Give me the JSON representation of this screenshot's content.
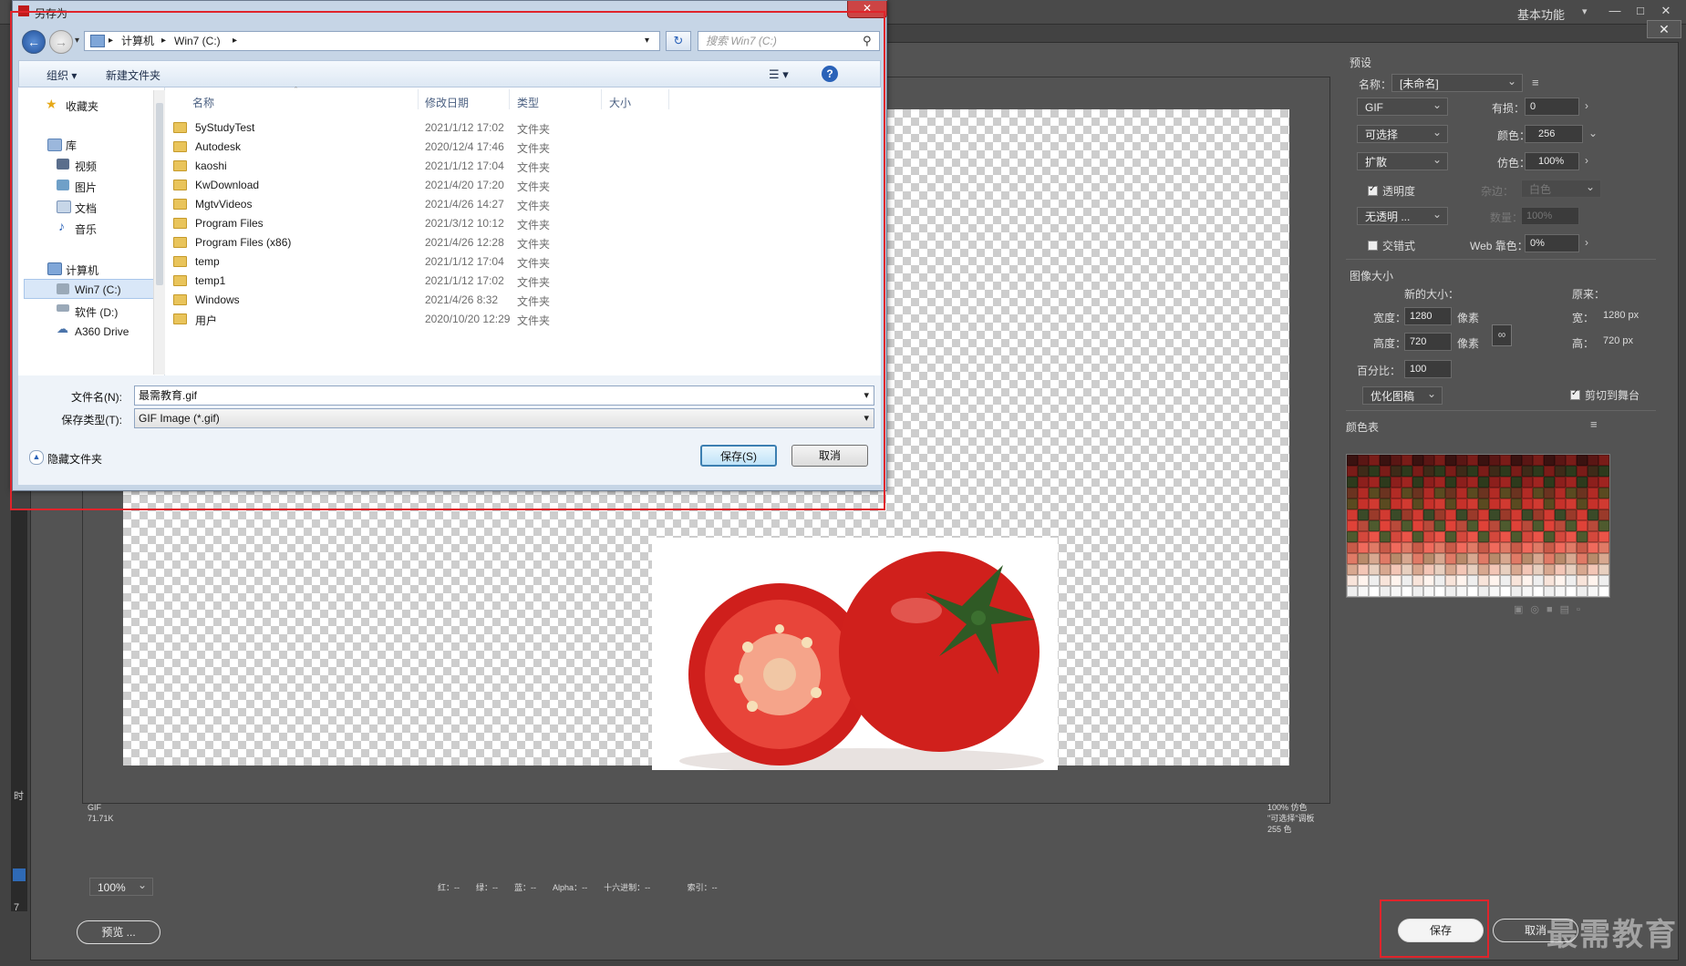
{
  "photoshop": {
    "workspace": "基本功能",
    "left_strip_chars": [
      "时",
      "7"
    ],
    "image_info_left": [
      "GIF",
      "71.71K"
    ],
    "image_info_right": [
      "100% 仿色",
      "\"可选择\"调板",
      "255 色"
    ],
    "zoom": "100%",
    "readout": {
      "r": "红：--",
      "g": "绿：--",
      "b": "蓝：--",
      "alpha": "Alpha：--",
      "hex": "十六进制：--",
      "index": "索引：--"
    },
    "preview_button": "预览 ...",
    "save_button": "保存",
    "cancel_button": "取消",
    "watermark": "最需教育"
  },
  "panel": {
    "preset_header": "预设",
    "name_label": "名称：",
    "name_value": "[未命名]",
    "format": "GIF",
    "lossy_label": "有损：",
    "lossy_value": "0",
    "reduction": "可选择",
    "colors_label": "颜色：",
    "colors_value": "256",
    "dither_algo": "扩散",
    "dither_label": "仿色：",
    "dither_value": "100%",
    "transparency_label": "透明度",
    "matte_label": "杂边：",
    "matte_value": "白色",
    "transparency_dither": "无透明 ...",
    "amount_label": "数量：",
    "amount_value": "100%",
    "interlaced_label": "交错式",
    "web_snap_label": "Web 靠色：",
    "web_snap_value": "0%",
    "image_size_header": "图像大小",
    "new_size_label": "新的大小：",
    "original_label": "原来：",
    "width_label": "宽度：",
    "width_value": "1280",
    "height_label": "高度：",
    "height_value": "720",
    "px_unit": "像素",
    "orig_w_label": "宽：",
    "orig_w_value": "1280 px",
    "orig_h_label": "高：",
    "orig_h_value": "720 px",
    "percent_label": "百分比：",
    "percent_value": "100",
    "quality": "优化图稿",
    "clip_label": "剪切到舞台",
    "color_table_header": "颜色表"
  },
  "palette_colors": [
    "#3a1210",
    "#5a1614",
    "#7a1c18",
    "#3e2a18",
    "#2d3a1c",
    "#8c1f1c",
    "#a02420",
    "#6b3320",
    "#b22b25",
    "#5a4a20",
    "#c6312a",
    "#d13a31",
    "#3a4a28",
    "#9a3a2a",
    "#e04238",
    "#b84a3a",
    "#4e5a2e",
    "#d4483c",
    "#ea5448",
    "#c85a48",
    "#f06a5c",
    "#e07a66",
    "#b88a6a",
    "#d8a890",
    "#f3c6b6",
    "#e8d0c0",
    "#f8e4da",
    "#fff4ee",
    "#efefef",
    "#f7f7f7",
    "#ffffff"
  ],
  "dialog": {
    "title": "另存为",
    "close": "✕",
    "path_root": "计算机",
    "path_drive": "Win7 (C:)",
    "search_placeholder": "搜索 Win7 (C:)",
    "organize": "组织 ▾",
    "new_folder": "新建文件夹",
    "help": "?",
    "nav": {
      "favorites": "收藏夹",
      "libraries": "库",
      "videos": "视频",
      "pictures": "图片",
      "documents": "文档",
      "music": "音乐",
      "computer": "计算机",
      "drive_c": "Win7 (C:)",
      "drive_d": "软件 (D:)",
      "a360": "A360 Drive"
    },
    "columns": {
      "name": "名称",
      "date": "修改日期",
      "type": "类型",
      "size": "大小"
    },
    "files": [
      {
        "name": "5yStudyTest",
        "date": "2021/1/12 17:02",
        "type": "文件夹"
      },
      {
        "name": "Autodesk",
        "date": "2020/12/4 17:46",
        "type": "文件夹"
      },
      {
        "name": "kaoshi",
        "date": "2021/1/12 17:04",
        "type": "文件夹"
      },
      {
        "name": "KwDownload",
        "date": "2021/4/20 17:20",
        "type": "文件夹"
      },
      {
        "name": "MgtvVideos",
        "date": "2021/4/26 14:27",
        "type": "文件夹"
      },
      {
        "name": "Program Files",
        "date": "2021/3/12 10:12",
        "type": "文件夹"
      },
      {
        "name": "Program Files (x86)",
        "date": "2021/4/26 12:28",
        "type": "文件夹"
      },
      {
        "name": "temp",
        "date": "2021/1/12 17:04",
        "type": "文件夹"
      },
      {
        "name": "temp1",
        "date": "2021/1/12 17:02",
        "type": "文件夹"
      },
      {
        "name": "Windows",
        "date": "2021/4/26 8:32",
        "type": "文件夹"
      },
      {
        "name": "用户",
        "date": "2020/10/20 12:29",
        "type": "文件夹"
      }
    ],
    "filename_label": "文件名(N):",
    "filename_value": "最需教育.gif",
    "filetype_label": "保存类型(T):",
    "filetype_value": "GIF Image (*.gif)",
    "hide_folders": "隐藏文件夹",
    "save_button": "保存(S)",
    "cancel_button": "取消"
  },
  "colors": {
    "highlight": "#e0242b",
    "accent": "#2a62b8"
  }
}
